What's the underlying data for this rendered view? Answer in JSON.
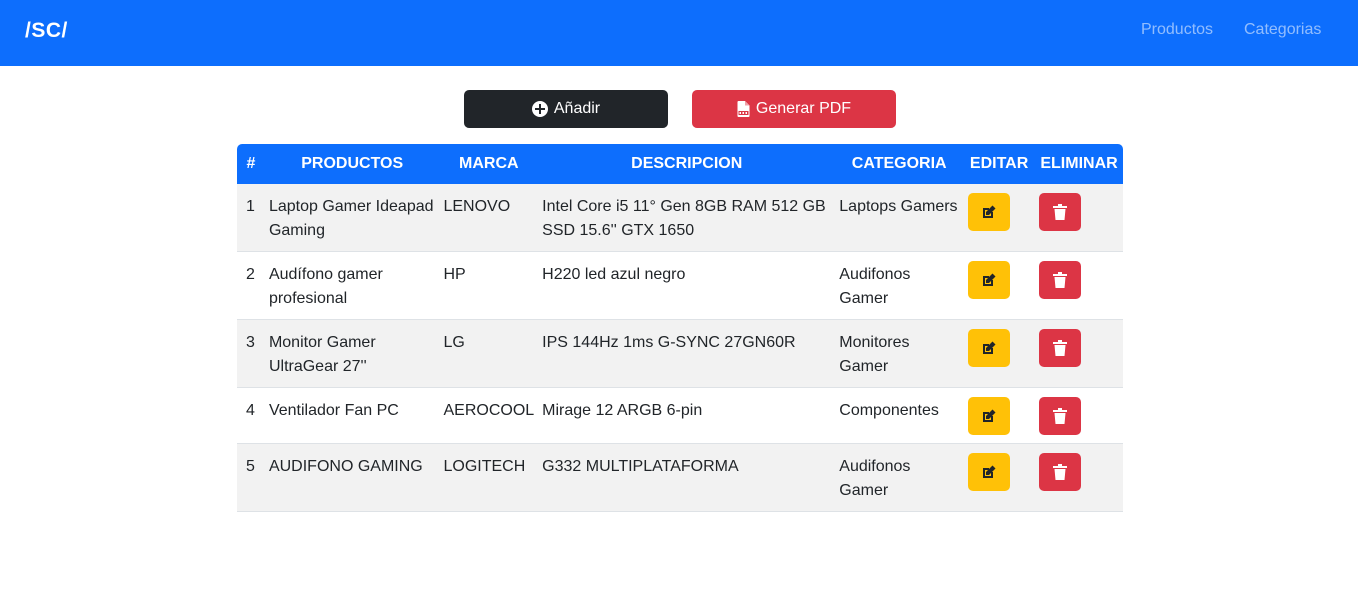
{
  "navbar": {
    "brand": "/SC/",
    "links": [
      "Productos",
      "Categorias"
    ]
  },
  "actions": {
    "add_label": "Añadir",
    "pdf_label": "Generar PDF"
  },
  "table": {
    "headers": [
      "#",
      "PRODUCTOS",
      "MARCA",
      "DESCRIPCION",
      "CATEGORIA",
      "EDITAR",
      "ELIMINAR"
    ],
    "rows": [
      {
        "num": "1",
        "producto": "Laptop Gamer Ideapad Gaming",
        "marca": "LENOVO",
        "descripcion": "Intel Core i5 11° Gen 8GB RAM 512 GB SSD 15.6'' GTX 1650",
        "categoria": "Laptops Gamers"
      },
      {
        "num": "2",
        "producto": "Audífono gamer profesional",
        "marca": "HP",
        "descripcion": "H220 led azul negro",
        "categoria": "Audifonos Gamer"
      },
      {
        "num": "3",
        "producto": "Monitor Gamer UltraGear 27''",
        "marca": "LG",
        "descripcion": "IPS 144Hz 1ms G-SYNC 27GN60R",
        "categoria": "Monitores Gamer"
      },
      {
        "num": "4",
        "producto": "Ventilador Fan PC",
        "marca": "AEROCOOL",
        "descripcion": "Mirage 12 ARGB 6-pin",
        "categoria": "Componentes"
      },
      {
        "num": "5",
        "producto": "AUDIFONO GAMING",
        "marca": "LOGITECH",
        "descripcion": "G332 MULTIPLATAFORMA",
        "categoria": "Audifonos Gamer"
      }
    ]
  },
  "icons": {
    "add": "plus-circle-icon",
    "pdf": "file-pdf-icon",
    "edit": "edit-icon",
    "delete": "trash-icon"
  },
  "colors": {
    "primary": "#0d6efd",
    "dark": "#212529",
    "danger": "#dc3545",
    "warning": "#ffc107"
  }
}
